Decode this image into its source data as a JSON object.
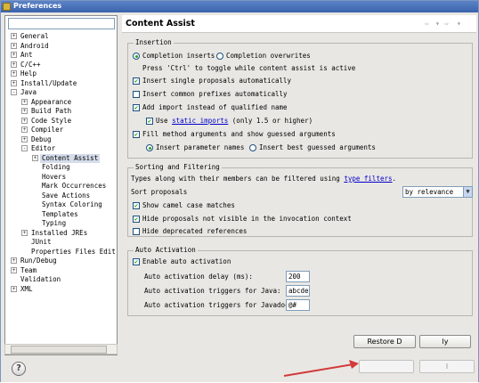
{
  "window": {
    "title": "Preferences"
  },
  "filter": {
    "value": ""
  },
  "tree": [
    {
      "label": "General",
      "expander": "+"
    },
    {
      "label": "Android",
      "expander": "+"
    },
    {
      "label": "Ant",
      "expander": "+"
    },
    {
      "label": "C/C++",
      "expander": "+"
    },
    {
      "label": "Help",
      "expander": "+"
    },
    {
      "label": "Install/Update",
      "expander": "+"
    },
    {
      "label": "Java",
      "expander": "-"
    },
    {
      "label": "Appearance",
      "expander": "+"
    },
    {
      "label": "Build Path",
      "expander": "+"
    },
    {
      "label": "Code Style",
      "expander": "+"
    },
    {
      "label": "Compiler",
      "expander": "+"
    },
    {
      "label": "Debug",
      "expander": "+"
    },
    {
      "label": "Editor",
      "expander": "-"
    },
    {
      "label": "Content Assist",
      "expander": "+"
    },
    {
      "label": "Folding",
      "expander": ""
    },
    {
      "label": "Hovers",
      "expander": ""
    },
    {
      "label": "Mark Occurrences",
      "expander": ""
    },
    {
      "label": "Save Actions",
      "expander": ""
    },
    {
      "label": "Syntax Coloring",
      "expander": ""
    },
    {
      "label": "Templates",
      "expander": ""
    },
    {
      "label": "Typing",
      "expander": ""
    },
    {
      "label": "Installed JREs",
      "expander": "+"
    },
    {
      "label": "JUnit",
      "expander": ""
    },
    {
      "label": "Properties Files Edit",
      "expander": ""
    },
    {
      "label": "Run/Debug",
      "expander": "+"
    },
    {
      "label": "Team",
      "expander": "+"
    },
    {
      "label": "Validation",
      "expander": ""
    },
    {
      "label": "XML",
      "expander": "+"
    }
  ],
  "header": {
    "title": "Content Assist",
    "nav_back": "⇦",
    "nav_back_menu": "▾",
    "nav_forward": "⇨",
    "nav_forward_menu": "▾"
  },
  "insertion": {
    "group_label": "Insertion",
    "completion_inserts": "Completion inserts",
    "completion_overwrites": "Completion overwrites",
    "toggle_hint": "Press 'Ctrl' to toggle while content assist is active",
    "insert_single": "Insert single proposals automatically",
    "insert_common": "Insert common prefixes automatically",
    "add_import": "Add import instead of qualified name",
    "use_prefix": "Use ",
    "static_imports_link": "static imports",
    "use_suffix": " (only 1.5 or higher)",
    "fill_method": "Fill method arguments and show guessed arguments",
    "insert_param_names": "Insert parameter names",
    "insert_best_guessed": "Insert best guessed arguments"
  },
  "sorting": {
    "group_label": "Sorting and Filtering",
    "types_prefix": "Types along with their members can be filtered using ",
    "type_filters_link": "type filters",
    "types_suffix": ".",
    "sort_proposals_label": "Sort proposals",
    "sort_proposals_value": "by relevance",
    "show_camel": "Show camel case matches",
    "hide_not_visible": "Hide proposals not visible in the invocation context",
    "hide_deprecated": "Hide deprecated references"
  },
  "activation": {
    "group_label": "Auto Activation",
    "enable": "Enable auto activation",
    "delay_label": "Auto activation delay (ms):",
    "delay_value": "200",
    "java_triggers_label": "Auto activation triggers for Java:",
    "java_triggers_value": "abcde",
    "javadoc_triggers_label": "Auto activation triggers for Javadoc:",
    "javadoc_triggers_value": "@#"
  },
  "buttons": {
    "restore_defaults": "Restore D",
    "apply": "ly",
    "ok": "",
    "cancel": "l"
  },
  "help": {
    "icon": "?"
  },
  "checks": {
    "mark": "✔"
  },
  "colors": {
    "accent": "#3a63ad",
    "link": "#0000cc",
    "annotation": "#d23a3a"
  }
}
